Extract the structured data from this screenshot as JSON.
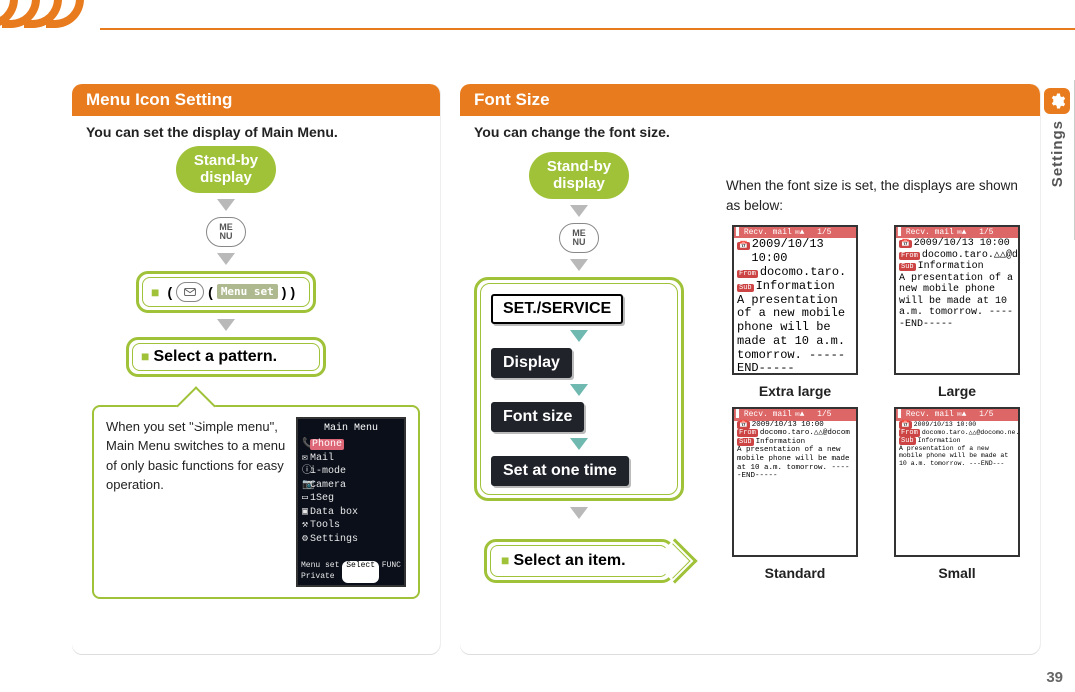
{
  "side": {
    "label": "Settings"
  },
  "page_number": "39",
  "left": {
    "header": "Menu Icon Setting",
    "desc": "You can set the display of Main Menu.",
    "standby": "Stand-by\ndisplay",
    "menu_key": "ME\nNU",
    "menu_set_chip": "Menu set",
    "select_pattern": "Select a pattern.",
    "note": "When you set \"Simple menu\", Main Menu switches to a menu of only basic functions for easy operation.",
    "mainmenu": {
      "title": "Main Menu",
      "items": [
        "Phone",
        "Mail",
        "i-mode",
        "Camera",
        "1Seg",
        "Data box",
        "Tools",
        "Settings"
      ],
      "soft_left": "Menu set",
      "soft_center": "Select",
      "soft_right": "FUNC",
      "soft_bl": "Private"
    }
  },
  "right": {
    "header": "Font Size",
    "desc": "You can change the font size.",
    "standby": "Stand-by\ndisplay",
    "menu_key": "ME\nNU",
    "steps": {
      "set_service": "SET./SERVICE",
      "display": "Display",
      "font_size": "Font size",
      "set_one": "Set at one time"
    },
    "select_item": "Select an item.",
    "info_lead": "When the font size is set, the displays are shown as below:",
    "labels": {
      "xl": "Extra large",
      "lg": "Large",
      "std": "Standard",
      "sm": "Small"
    },
    "sample": {
      "bar": "Recv. mail",
      "page_frac": "1/5",
      "date": "2009/10/13",
      "time": "10:00",
      "from_label": "From",
      "from": "docomo.taro.",
      "from_long": "docomo.taro.△△@docomo.ne.",
      "sub_label": "Sub",
      "sub": "Information",
      "body_xl": "A presentation of a new mobile phone will be made at 10 a.m. tomorrow.\n-----END-----",
      "body_lg": "A presentation of a new mobile phone will be made at 10 a.m. tomorrow.\n-----END-----",
      "body_std": "A presentation of a new mobile phone will be made at 10 a.m. tomorrow.\n-----END-----",
      "body_sm": "A presentation of a new mobile phone will be made at 10 a.m. tomorrow.\n---END---"
    }
  }
}
